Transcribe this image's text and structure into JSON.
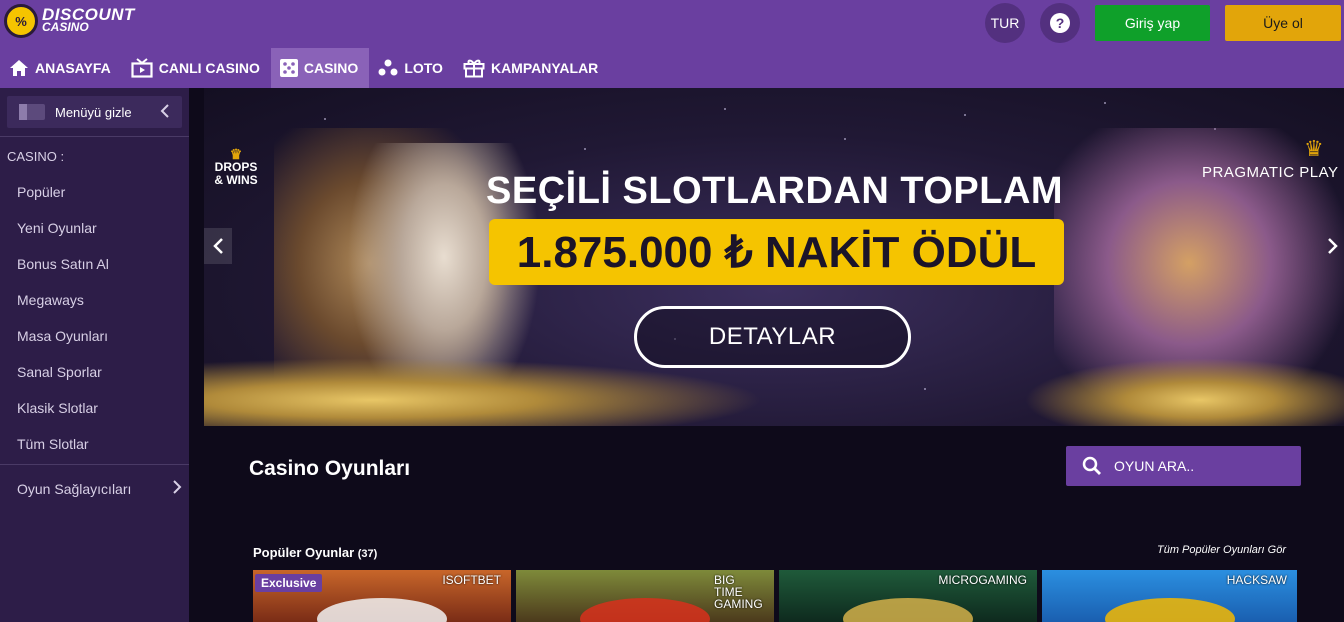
{
  "header": {
    "logo_line1": "DISCOUNT",
    "logo_line2": "CASINO",
    "logo_badge": "%",
    "language": "TUR",
    "help_symbol": "?",
    "login_label": "Giriş yap",
    "signup_label": "Üye ol",
    "colors": {
      "bar": "#6a3fa0",
      "login": "#0fa02a",
      "signup": "#e2a50a"
    }
  },
  "nav": {
    "items": [
      {
        "label": "ANASAYFA",
        "icon": "home-icon",
        "active": false
      },
      {
        "label": "CANLI CASINO",
        "icon": "tv-play-icon",
        "active": false
      },
      {
        "label": "CASINO",
        "icon": "dice-icon",
        "active": true
      },
      {
        "label": "LOTO",
        "icon": "balls-icon",
        "active": false
      },
      {
        "label": "KAMPANYALAR",
        "icon": "gift-icon",
        "active": false
      }
    ]
  },
  "sidebar": {
    "hide_label": "Menüyü gizle",
    "section_label": "CASINO :",
    "items": [
      "Popüler",
      "Yeni Oyunlar",
      "Bonus Satın Al",
      "Megaways",
      "Masa Oyunları",
      "Sanal Sporlar",
      "Klasik Slotlar",
      "Tüm Slotlar"
    ],
    "providers_label": "Oyun Sağlayıcıları"
  },
  "banner": {
    "badge_line1": "DROPS",
    "badge_line2": "& WINS",
    "brand": "PRAGMATIC PLAY",
    "headline": "SEÇİLİ SLOTLARDAN TOPLAM",
    "prize": "1.875.000 ₺ NAKİT ÖDÜL",
    "cta": "DETAYLAR"
  },
  "games": {
    "title": "Casino Oyunları",
    "search_placeholder": "OYUN ARA..",
    "popular_label": "Popüler Oyunlar",
    "popular_count": "(37)",
    "see_all": "Tüm Popüler Oyunları Gör",
    "tiles": [
      {
        "provider": "ISOFTBET",
        "badge": "Exclusive"
      },
      {
        "provider": "BIG TIME GAMING",
        "badge": ""
      },
      {
        "provider": "MICROGAMING",
        "badge": ""
      },
      {
        "provider": "HACKSAW",
        "badge": ""
      }
    ]
  }
}
